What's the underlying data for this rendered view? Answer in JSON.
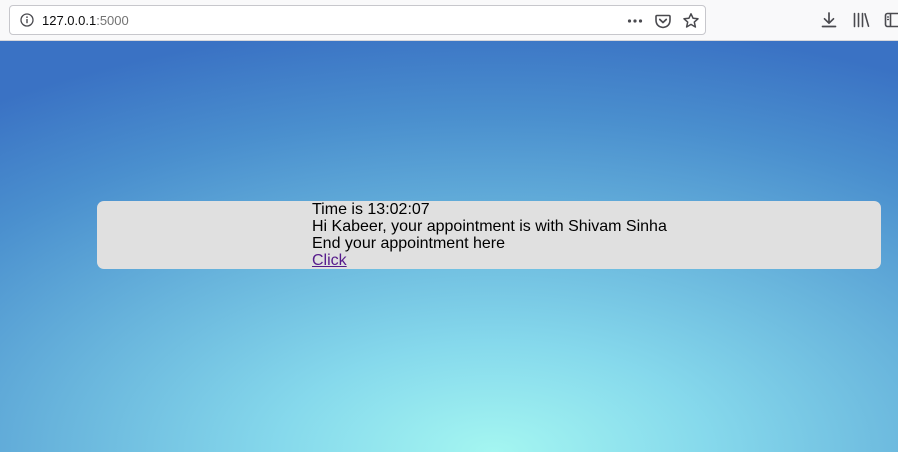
{
  "browser": {
    "url_host": "127.0.0.1",
    "url_port": ":5000",
    "icons": {
      "site_info": "info-icon",
      "page_actions": "more-icon",
      "pocket": "pocket-icon",
      "bookmark": "star-icon",
      "downloads": "download-icon",
      "library": "library-icon",
      "sidebar": "sidebar-icon"
    }
  },
  "appointment": {
    "time_line": "Time is 13:02:07",
    "greeting_line": "Hi Kabeer, your appointment is with Shivam Sinha",
    "end_line": "End your appointment here",
    "link_label": "Click"
  },
  "colors": {
    "card_background": "#e0e0e0",
    "link_color": "#551a8b",
    "background_top": "#3a72c4",
    "background_glow": "#a4f6f1"
  }
}
